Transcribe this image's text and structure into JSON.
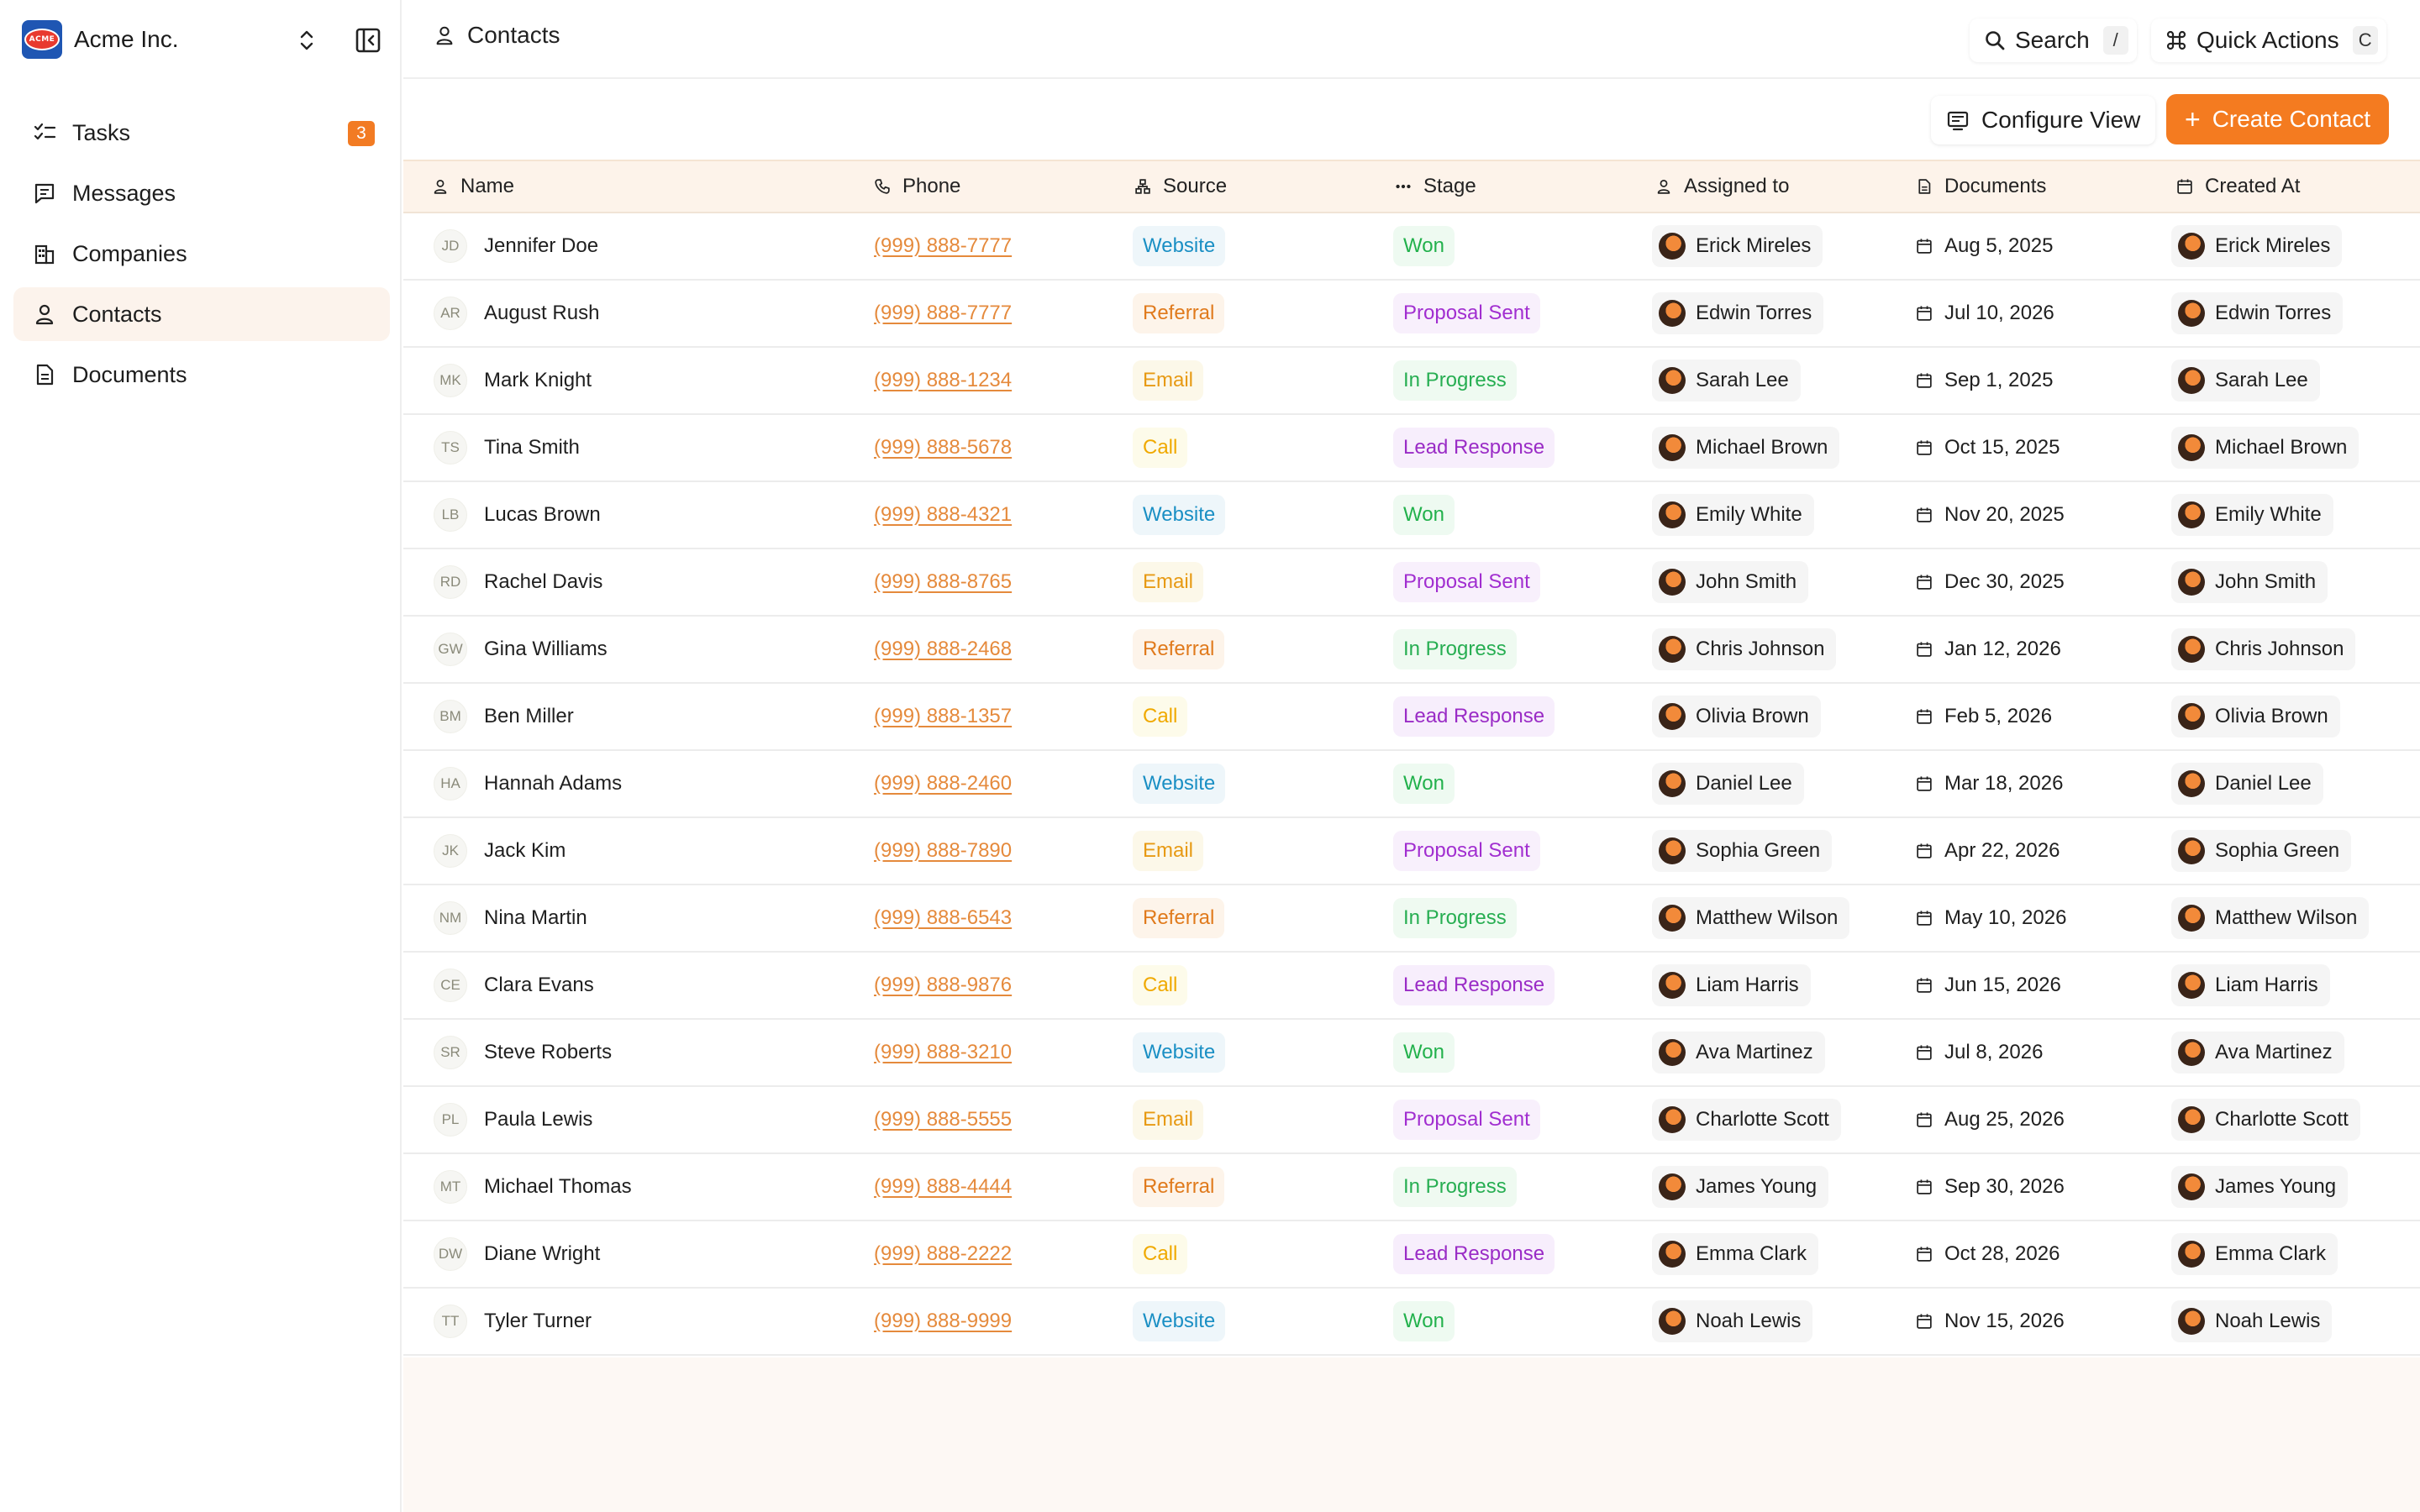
{
  "brand": {
    "name": "Acme Inc.",
    "logo_text": "ACME"
  },
  "sidebar": {
    "items": [
      {
        "label": "Tasks",
        "icon": "checklist-icon",
        "badge": "3",
        "active": false
      },
      {
        "label": "Messages",
        "icon": "message-icon",
        "active": false
      },
      {
        "label": "Companies",
        "icon": "building-icon",
        "active": false
      },
      {
        "label": "Contacts",
        "icon": "user-icon",
        "active": true
      },
      {
        "label": "Documents",
        "icon": "document-icon",
        "active": false
      }
    ]
  },
  "header": {
    "breadcrumb": "Contacts",
    "search_label": "Search",
    "search_shortcut": "/",
    "quick_actions_label": "Quick Actions",
    "quick_actions_shortcut": "C"
  },
  "toolbar": {
    "configure_label": "Configure View",
    "create_label": "Create Contact"
  },
  "colors": {
    "accent": "#f47b20",
    "header_bg": "#fdf3ea",
    "active_nav": "#fcf3ec"
  },
  "table": {
    "columns": [
      "Name",
      "Phone",
      "Source",
      "Stage",
      "Assigned to",
      "Documents",
      "Created At"
    ],
    "rows": [
      {
        "initials": "JD",
        "name": "Jennifer Doe",
        "phone": "(999) 888-7777",
        "source": "Website",
        "stage": "Won",
        "assigned": "Erick Mireles",
        "date": "Aug 5, 2025",
        "created_by": "Erick Mireles"
      },
      {
        "initials": "AR",
        "name": "August Rush",
        "phone": "(999) 888-7777",
        "source": "Referral",
        "stage": "Proposal Sent",
        "assigned": "Edwin Torres",
        "date": "Jul 10, 2026",
        "created_by": "Edwin Torres"
      },
      {
        "initials": "MK",
        "name": "Mark Knight",
        "phone": "(999) 888-1234",
        "source": "Email",
        "stage": "In Progress",
        "assigned": "Sarah Lee",
        "date": "Sep 1, 2025",
        "created_by": "Sarah Lee"
      },
      {
        "initials": "TS",
        "name": "Tina Smith",
        "phone": "(999) 888-5678",
        "source": "Call",
        "stage": "Lead Response",
        "assigned": "Michael Brown",
        "date": "Oct 15, 2025",
        "created_by": "Michael Brown"
      },
      {
        "initials": "LB",
        "name": "Lucas Brown",
        "phone": "(999) 888-4321",
        "source": "Website",
        "stage": "Won",
        "assigned": "Emily White",
        "date": "Nov 20, 2025",
        "created_by": "Emily White"
      },
      {
        "initials": "RD",
        "name": "Rachel Davis",
        "phone": "(999) 888-8765",
        "source": "Email",
        "stage": "Proposal Sent",
        "assigned": "John Smith",
        "date": "Dec 30, 2025",
        "created_by": "John Smith"
      },
      {
        "initials": "GW",
        "name": "Gina Williams",
        "phone": "(999) 888-2468",
        "source": "Referral",
        "stage": "In Progress",
        "assigned": "Chris Johnson",
        "date": "Jan 12, 2026",
        "created_by": "Chris Johnson"
      },
      {
        "initials": "BM",
        "name": "Ben Miller",
        "phone": "(999) 888-1357",
        "source": "Call",
        "stage": "Lead Response",
        "assigned": "Olivia Brown",
        "date": "Feb 5, 2026",
        "created_by": "Olivia Brown"
      },
      {
        "initials": "HA",
        "name": "Hannah Adams",
        "phone": "(999) 888-2460",
        "source": "Website",
        "stage": "Won",
        "assigned": "Daniel Lee",
        "date": "Mar 18, 2026",
        "created_by": "Daniel Lee"
      },
      {
        "initials": "JK",
        "name": "Jack Kim",
        "phone": "(999) 888-7890",
        "source": "Email",
        "stage": "Proposal Sent",
        "assigned": "Sophia Green",
        "date": "Apr 22, 2026",
        "created_by": "Sophia Green"
      },
      {
        "initials": "NM",
        "name": "Nina Martin",
        "phone": "(999) 888-6543",
        "source": "Referral",
        "stage": "In Progress",
        "assigned": "Matthew Wilson",
        "date": "May 10, 2026",
        "created_by": "Matthew Wilson"
      },
      {
        "initials": "CE",
        "name": "Clara Evans",
        "phone": "(999) 888-9876",
        "source": "Call",
        "stage": "Lead Response",
        "assigned": "Liam Harris",
        "date": "Jun 15, 2026",
        "created_by": "Liam Harris"
      },
      {
        "initials": "SR",
        "name": "Steve Roberts",
        "phone": "(999) 888-3210",
        "source": "Website",
        "stage": "Won",
        "assigned": "Ava Martinez",
        "date": "Jul 8, 2026",
        "created_by": "Ava Martinez"
      },
      {
        "initials": "PL",
        "name": "Paula Lewis",
        "phone": "(999) 888-5555",
        "source": "Email",
        "stage": "Proposal Sent",
        "assigned": "Charlotte Scott",
        "date": "Aug 25, 2026",
        "created_by": "Charlotte Scott"
      },
      {
        "initials": "MT",
        "name": "Michael Thomas",
        "phone": "(999) 888-4444",
        "source": "Referral",
        "stage": "In Progress",
        "assigned": "James Young",
        "date": "Sep 30, 2026",
        "created_by": "James Young"
      },
      {
        "initials": "DW",
        "name": "Diane Wright",
        "phone": "(999) 888-2222",
        "source": "Call",
        "stage": "Lead Response",
        "assigned": "Emma Clark",
        "date": "Oct 28, 2026",
        "created_by": "Emma Clark"
      },
      {
        "initials": "TT",
        "name": "Tyler Turner",
        "phone": "(999) 888-9999",
        "source": "Website",
        "stage": "Won",
        "assigned": "Noah Lewis",
        "date": "Nov 15, 2026",
        "created_by": "Noah Lewis"
      }
    ]
  }
}
